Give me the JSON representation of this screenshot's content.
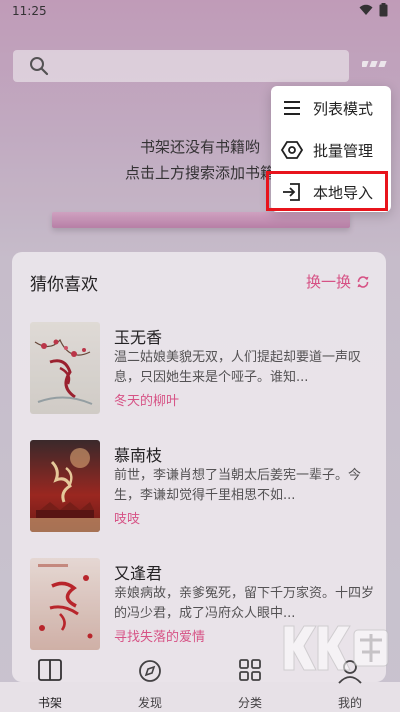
{
  "status": {
    "time": "11:25"
  },
  "search": {
    "placeholder": ""
  },
  "empty_state": {
    "line1": "书架还没有书籍哟",
    "line2": "点击上方搜索添加书籍"
  },
  "popup": {
    "items": [
      {
        "label": "列表模式",
        "icon": "list-icon"
      },
      {
        "label": "批量管理",
        "icon": "hexagon-settings-icon"
      },
      {
        "label": "本地导入",
        "icon": "import-icon"
      }
    ]
  },
  "recommend": {
    "title": "猜你喜欢",
    "refresh_label": "换一换",
    "books": [
      {
        "title": "玉无香",
        "desc": "温二姑娘美貌无双，人们提起却要道一声叹息，只因她生来是个哑子。谁知...",
        "author": "冬天的柳叶"
      },
      {
        "title": "慕南枝",
        "desc": "前世，李谦肖想了当朝太后姜宪一辈子。今生，李谦却觉得千里相思不如...",
        "author": "吱吱"
      },
      {
        "title": "又逢君",
        "desc": "亲娘病故，亲爹冤死，留下千万家资。十四岁的冯少君，成了冯府众人眼中...",
        "author": "寻找失落的爱情"
      }
    ]
  },
  "nav": {
    "items": [
      {
        "label": "书架",
        "icon": "book-icon"
      },
      {
        "label": "发现",
        "icon": "compass-icon"
      },
      {
        "label": "分类",
        "icon": "grid-icon"
      },
      {
        "label": "我的",
        "icon": "person-icon"
      }
    ]
  },
  "watermark_text": "KK下载"
}
